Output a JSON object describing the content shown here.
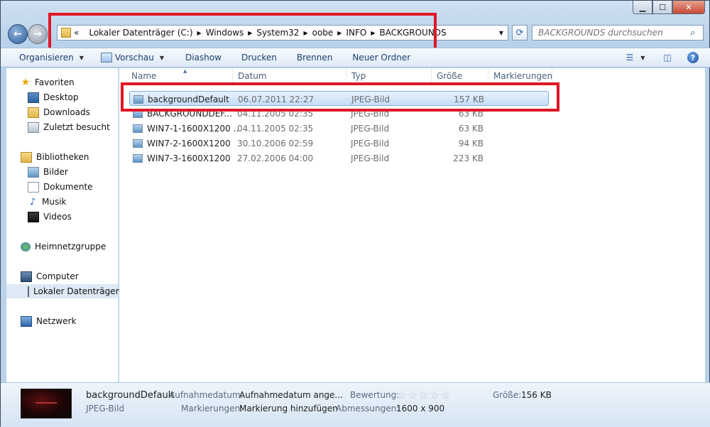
{
  "window": {
    "caption_buttons": [
      "minimize",
      "maximize",
      "close"
    ]
  },
  "address": {
    "overflow": "«",
    "crumbs": [
      "Lokaler Datenträger (C:)",
      "Windows",
      "System32",
      "oobe",
      "INFO",
      "BACKGROUNDS"
    ]
  },
  "search": {
    "placeholder": "BACKGROUNDS durchsuchen"
  },
  "toolbar": {
    "organize": "Organisieren",
    "preview": "Vorschau",
    "slideshow": "Diashow",
    "print": "Drucken",
    "burn": "Brennen",
    "new_folder": "Neuer Ordner"
  },
  "nav": {
    "favorites": "Favoriten",
    "desktop": "Desktop",
    "downloads": "Downloads",
    "recent": "Zuletzt besucht",
    "libraries": "Bibliotheken",
    "pictures": "Bilder",
    "documents": "Dokumente",
    "music": "Musik",
    "videos": "Videos",
    "homegroup": "Heimnetzgruppe",
    "computer": "Computer",
    "local_disk": "Lokaler Datenträger",
    "network": "Netzwerk"
  },
  "columns": {
    "name": "Name",
    "date": "Datum",
    "type": "Typ",
    "size": "Größe",
    "tags": "Markierungen"
  },
  "files": [
    {
      "name": "backgroundDefault",
      "date": "06.07.2011 22:27",
      "type": "JPEG-Bild",
      "size": "157 KB",
      "selected": true
    },
    {
      "name": "BACKGROUNDDEF...",
      "date": "04.11.2005 02:35",
      "type": "JPEG-Bild",
      "size": "63 KB",
      "selected": false
    },
    {
      "name": "WIN7-1-1600X1200 ...",
      "date": "04.11.2005 02:35",
      "type": "JPEG-Bild",
      "size": "63 KB",
      "selected": false
    },
    {
      "name": "WIN7-2-1600X1200",
      "date": "30.10.2006 02:59",
      "type": "JPEG-Bild",
      "size": "94 KB",
      "selected": false
    },
    {
      "name": "WIN7-3-1600X1200",
      "date": "27.02.2006 04:00",
      "type": "JPEG-Bild",
      "size": "223 KB",
      "selected": false
    }
  ],
  "details": {
    "filename": "backgroundDefault",
    "filetype": "JPEG-Bild",
    "date_label": "Aufnahmedatum:",
    "date_value": "Aufnahmedatum ange...",
    "tags_label": "Markierungen:",
    "tags_value": "Markierung hinzufügen",
    "rating_label": "Bewertung:",
    "rating_stars": 0,
    "dims_label": "Abmessungen:",
    "dims_value": "1600 x 900",
    "size_label": "Größe:",
    "size_value": "156 KB"
  },
  "colors": {
    "highlight": "#e01626",
    "selection": "#c4ddf7"
  }
}
